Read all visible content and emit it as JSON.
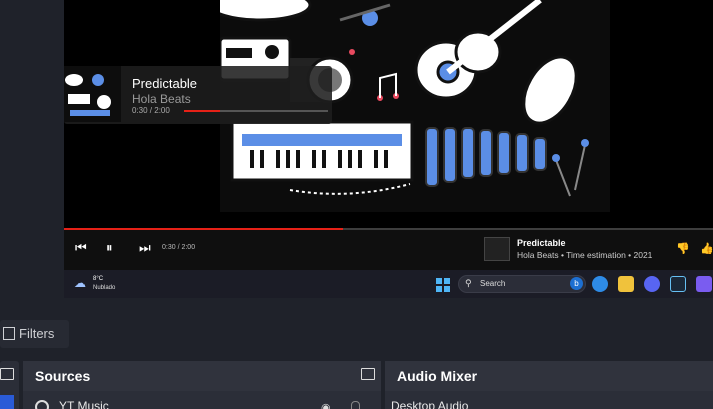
{
  "overlay": {
    "title": "Predictable",
    "artist": "Hola Beats",
    "time": "0:30 / 2:00",
    "progress_fraction": 0.25
  },
  "player": {
    "time": "0:30 / 2:00",
    "title": "Predictable",
    "subtitle": "Hola Beats • Time estimation • 2021",
    "progress_fraction": 0.43
  },
  "taskbar": {
    "temperature": "8°C",
    "condition": "Nublado",
    "search_placeholder": "Search"
  },
  "filters": {
    "label": "Filters"
  },
  "sources": {
    "title": "Sources",
    "item": "YT Music"
  },
  "audio_mixer": {
    "title": "Audio Mixer",
    "item": "Desktop Audio"
  },
  "colors": {
    "accent_red": "#e62117",
    "windows_blue": "#4fb5f5",
    "panel_bg": "#2b2e38"
  }
}
